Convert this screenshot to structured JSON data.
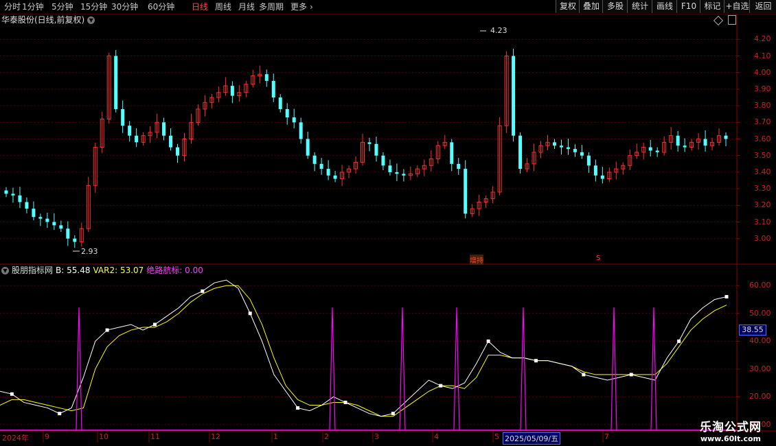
{
  "toolbar": {
    "periods": [
      "分时",
      "1分钟",
      "5分钟",
      "15分钟",
      "30分钟",
      "60分钟",
      "日线",
      "周线",
      "月线",
      "多周期",
      "更多"
    ],
    "active_period": "日线",
    "more_icon": "chevron-right-icon",
    "buttons": [
      "复权",
      "叠加",
      "多股",
      "统计",
      "画线",
      "F10",
      "标记",
      "+自选",
      "返回"
    ]
  },
  "main_chart": {
    "title": "华泰股份(日线,前复权)",
    "high_label": "4.23",
    "low_label": "2.93",
    "signal_label_1": "增持",
    "signal_label_2": "S",
    "price_axis": [
      "4.20",
      "4.10",
      "4.00",
      "3.90",
      "3.80",
      "3.70",
      "3.60",
      "3.50",
      "3.40",
      "3.30",
      "3.20",
      "3.10",
      "3.00"
    ]
  },
  "indicator": {
    "name": "股朋指标网",
    "b_label": "B: 55.48",
    "var2_label": "VAR2: 53.07",
    "nav_label": "绝路航标: 0.00",
    "axis": [
      "60.00",
      "50.00",
      "40.00",
      "30.00",
      "20.00",
      "10.00"
    ],
    "crosshair_value": "38.55",
    "colors": {
      "b": "#ffffff",
      "var2": "#ffff00",
      "nav": "#ff00ff"
    }
  },
  "date_axis": {
    "year": "2024年",
    "months": [
      "9",
      "10",
      "11",
      "12",
      "1",
      "2",
      "3",
      "4",
      "5",
      "7"
    ],
    "cursor_date": "2025/05/09/五"
  },
  "watermark": {
    "line1": "乐淘公式网",
    "line2": "www.60lt.com"
  },
  "chart_data": {
    "type": "candlestick+line",
    "price": {
      "ylim": [
        2.85,
        4.28
      ],
      "high": 4.23,
      "low": 2.93,
      "close_path": [
        3.27,
        3.26,
        3.22,
        3.18,
        3.13,
        3.12,
        3.1,
        3.08,
        3.06,
        3.0,
        2.98,
        3.06,
        3.32,
        3.55,
        3.72,
        4.1,
        3.78,
        3.68,
        3.62,
        3.58,
        3.62,
        3.64,
        3.7,
        3.62,
        3.55,
        3.5,
        3.6,
        3.7,
        3.78,
        3.82,
        3.85,
        3.88,
        3.92,
        3.86,
        3.88,
        3.93,
        3.98,
        3.99,
        3.95,
        3.85,
        3.78,
        3.73,
        3.7,
        3.6,
        3.5,
        3.45,
        3.42,
        3.38,
        3.36,
        3.4,
        3.42,
        3.46,
        3.58,
        3.57,
        3.5,
        3.44,
        3.4,
        3.39,
        3.38,
        3.39,
        3.42,
        3.44,
        3.48,
        3.56,
        3.58,
        3.45,
        3.42,
        3.15,
        3.18,
        3.22,
        3.24,
        3.28,
        3.68,
        4.1,
        3.62,
        3.42,
        3.45,
        3.52,
        3.56,
        3.58,
        3.56,
        3.55,
        3.54,
        3.52,
        3.5,
        3.44,
        3.38,
        3.36,
        3.4,
        3.42,
        3.44,
        3.5,
        3.52,
        3.55,
        3.53,
        3.52,
        3.58,
        3.62,
        3.56,
        3.55,
        3.58,
        3.6,
        3.56,
        3.58,
        3.62,
        3.6
      ]
    },
    "indicator": {
      "ylim": [
        8,
        64
      ],
      "b": [
        22,
        21,
        18,
        17,
        16,
        14,
        16,
        27,
        40,
        44,
        45,
        46,
        44,
        46,
        49,
        52,
        56,
        58,
        61,
        62,
        59,
        50,
        40,
        28,
        22,
        16,
        15,
        17,
        20,
        18,
        16,
        14,
        13,
        14,
        18,
        22,
        26,
        24,
        23,
        25,
        32,
        40,
        36,
        34,
        34,
        33,
        33,
        32,
        31,
        28,
        27,
        26,
        27,
        28,
        27,
        26,
        34,
        40,
        48,
        52,
        55,
        56
      ],
      "var2": [
        17,
        19,
        19,
        18,
        17,
        16,
        15,
        16,
        30,
        38,
        42,
        44,
        45,
        45,
        47,
        50,
        54,
        57,
        59,
        60,
        60,
        55,
        46,
        34,
        24,
        19,
        17,
        17,
        18,
        18,
        17,
        15,
        13,
        13,
        16,
        19,
        22,
        24,
        24,
        23,
        27,
        35,
        35,
        34,
        34,
        33,
        33,
        32,
        31,
        29,
        28,
        28,
        28,
        28,
        28,
        28,
        32,
        38,
        44,
        48,
        51,
        53
      ]
    }
  }
}
